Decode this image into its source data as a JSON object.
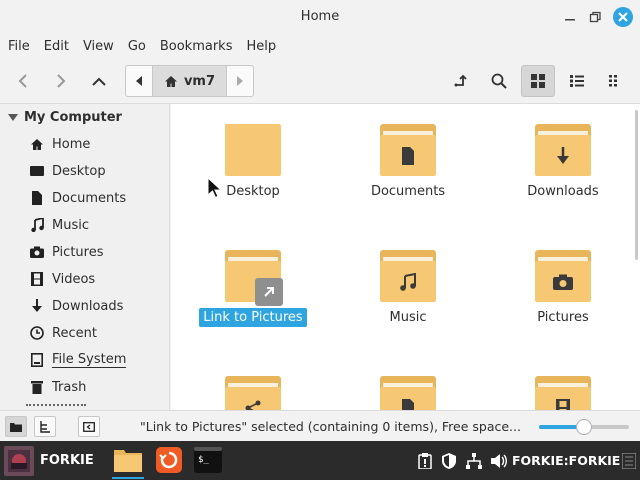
{
  "window": {
    "title": "Home"
  },
  "menu": [
    "File",
    "Edit",
    "View",
    "Go",
    "Bookmarks",
    "Help"
  ],
  "breadcrumb": {
    "current": "vm7"
  },
  "sidebar": {
    "header": "My Computer",
    "items": [
      {
        "label": "Home",
        "icon": "home-icon"
      },
      {
        "label": "Desktop",
        "icon": "desktop-icon"
      },
      {
        "label": "Documents",
        "icon": "document-icon"
      },
      {
        "label": "Music",
        "icon": "music-icon"
      },
      {
        "label": "Pictures",
        "icon": "camera-icon"
      },
      {
        "label": "Videos",
        "icon": "film-icon"
      },
      {
        "label": "Downloads",
        "icon": "download-icon"
      },
      {
        "label": "Recent",
        "icon": "clock-icon"
      },
      {
        "label": "File System",
        "icon": "drive-icon"
      },
      {
        "label": "Trash",
        "icon": "trash-icon"
      }
    ]
  },
  "files": [
    {
      "name": "Desktop",
      "emblem": "none"
    },
    {
      "name": "Documents",
      "emblem": "document-icon"
    },
    {
      "name": "Downloads",
      "emblem": "download-icon"
    },
    {
      "name": "Link to Pictures",
      "emblem": "link-icon",
      "selected": true
    },
    {
      "name": "Music",
      "emblem": "music-icon"
    },
    {
      "name": "Pictures",
      "emblem": "camera-icon"
    }
  ],
  "status": {
    "text": "\"Link to Pictures\" selected (containing 0 items), Free space...",
    "zoom_fraction": 0.5
  },
  "taskbar": {
    "start_label": "FORKIE",
    "hostname": "FORKIE:FORKIE"
  },
  "colors": {
    "accent": "#2ea5e0",
    "folder": "#f7c873",
    "folder_back": "#e9b55a"
  }
}
